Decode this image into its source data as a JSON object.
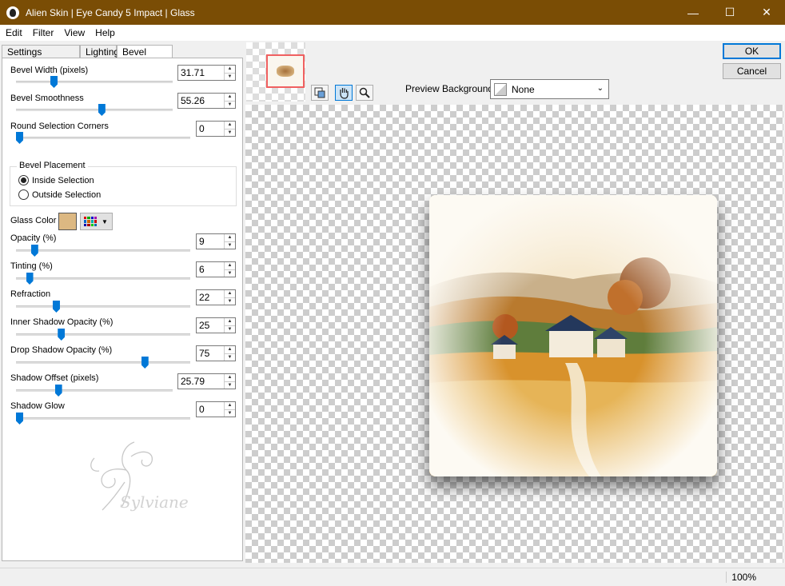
{
  "window": {
    "title": "Alien Skin | Eye Candy 5 Impact | Glass",
    "buttons": {
      "minimize": "—",
      "maximize": "☐",
      "close": "✕"
    }
  },
  "menu": [
    {
      "label": "Edit"
    },
    {
      "label": "Filter"
    },
    {
      "label": "View"
    },
    {
      "label": "Help"
    }
  ],
  "tabs": [
    {
      "label": "Settings"
    },
    {
      "label": "Lighting"
    },
    {
      "label": "Bevel Profile"
    }
  ],
  "controls": {
    "bevel_width": {
      "label": "Bevel Width (pixels)",
      "value": "31.71",
      "level": 0.23
    },
    "bevel_smoothness": {
      "label": "Bevel Smoothness",
      "value": "55.26",
      "level": 0.55
    },
    "round_corners": {
      "label": "Round Selection Corners",
      "value": "0",
      "level": 0.0
    },
    "opacity": {
      "label": "Opacity (%)",
      "value": "9",
      "level": 0.09
    },
    "tinting": {
      "label": "Tinting (%)",
      "value": "6",
      "level": 0.06
    },
    "refraction": {
      "label": "Refraction",
      "value": "22",
      "level": 0.22
    },
    "inner_shadow": {
      "label": "Inner Shadow Opacity (%)",
      "value": "25",
      "level": 0.25
    },
    "drop_shadow": {
      "label": "Drop Shadow Opacity (%)",
      "value": "75",
      "level": 0.75
    },
    "shadow_offset": {
      "label": "Shadow Offset (pixels)",
      "value": "25.79",
      "level": 0.26
    },
    "shadow_glow": {
      "label": "Shadow Glow",
      "value": "0",
      "level": 0.0
    }
  },
  "placement": {
    "title": "Bevel Placement",
    "inside": "Inside Selection",
    "outside": "Outside Selection",
    "selected": "inside"
  },
  "glass_color": {
    "label": "Glass Color",
    "color": "#dcb882"
  },
  "watermark": "Sylviane",
  "preview_background": {
    "label": "Preview Background:",
    "value": "None"
  },
  "dialog": {
    "ok": "OK",
    "cancel": "Cancel"
  },
  "status": {
    "zoom": "100%"
  },
  "colors": {
    "titlebar": "#7a4d05",
    "accent": "#0078d7"
  },
  "icons": {
    "tool1": "thumbnail-navigator-icon",
    "tool2": "hand-icon",
    "tool3": "magnifier-icon"
  }
}
